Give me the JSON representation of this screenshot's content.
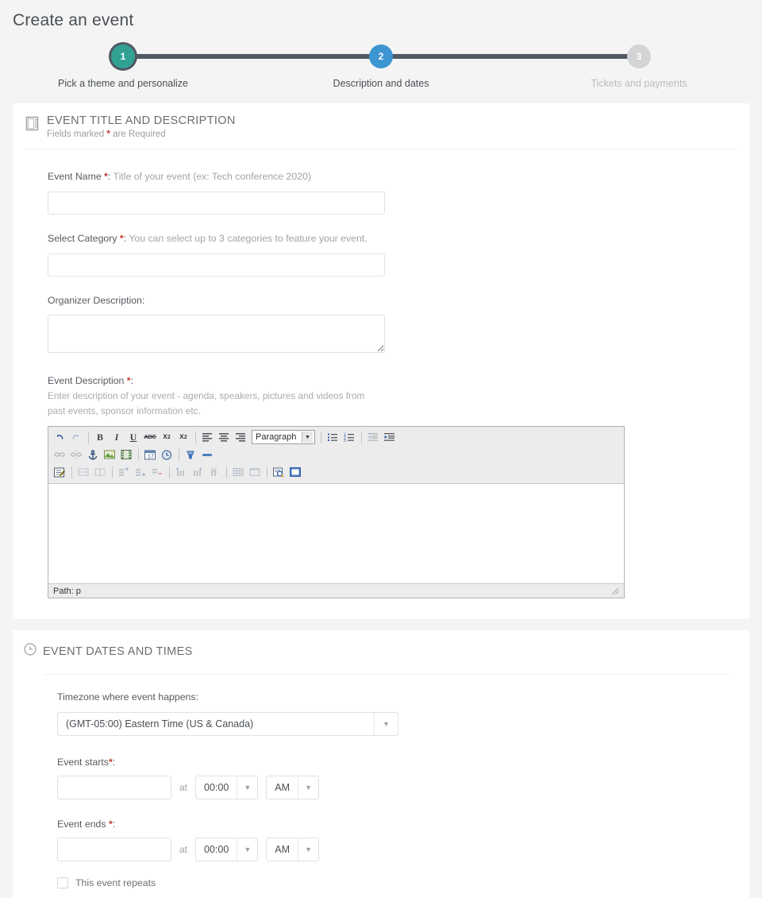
{
  "page": {
    "title": "Create an event"
  },
  "stepper": {
    "steps": [
      {
        "number": "1",
        "label": "Pick a theme and personalize",
        "state": "complete",
        "color": "#31a192"
      },
      {
        "number": "2",
        "label": "Description and dates",
        "state": "current",
        "color": "#3d95d1"
      },
      {
        "number": "3",
        "label": "Tickets and payments",
        "state": "upcoming",
        "color": "#d3d4d5"
      }
    ],
    "line_color": "#515864"
  },
  "section_title_desc": {
    "icon": "notebook-icon",
    "heading": "EVENT TITLE AND DESCRIPTION",
    "sub_prefix": "Fields marked",
    "sub_required_mark": "*",
    "sub_suffix": "are Required",
    "required_color": "#c0392b"
  },
  "fields": {
    "event_name": {
      "label": "Event Name",
      "required_mark": "*",
      "colon": ":",
      "hint": "Title of your event (ex: Tech conference 2020)",
      "value": "",
      "placeholder": ""
    },
    "select_category": {
      "label": "Select Category",
      "required_mark": "*",
      "colon": ":",
      "hint": "You can select up to 3 categories to feature your event.",
      "value": "",
      "placeholder": ""
    },
    "organizer_description": {
      "label": "Organizer Description:",
      "value": "",
      "placeholder": ""
    },
    "event_description": {
      "label": "Event Description",
      "required_mark": "*",
      "colon": ":",
      "help": "Enter description of your event - agenda, speakers, pictures and videos from past events, sponsor information etc."
    }
  },
  "editor": {
    "format_select": "Paragraph",
    "status_path": "Path: p",
    "row1": [
      {
        "name": "undo-icon",
        "glyph": "↶"
      },
      {
        "name": "redo-icon",
        "glyph": "↷"
      },
      {
        "name": "separator",
        "glyph": "|"
      },
      {
        "name": "bold-icon",
        "glyph": "B"
      },
      {
        "name": "italic-icon",
        "glyph": "I"
      },
      {
        "name": "underline-icon",
        "glyph": "U"
      },
      {
        "name": "strikethrough-icon",
        "glyph": "ABC"
      },
      {
        "name": "subscript-icon",
        "glyph": "x₂"
      },
      {
        "name": "superscript-icon",
        "glyph": "x²"
      },
      {
        "name": "separator",
        "glyph": "|"
      },
      {
        "name": "align-left-icon",
        "glyph": "≡"
      },
      {
        "name": "align-center-icon",
        "glyph": "≡"
      },
      {
        "name": "align-right-icon",
        "glyph": "≡"
      },
      {
        "name": "format-select",
        "glyph": "Paragraph"
      },
      {
        "name": "separator",
        "glyph": "|"
      },
      {
        "name": "bullet-list-icon",
        "glyph": "☰"
      },
      {
        "name": "numbered-list-icon",
        "glyph": "☰"
      },
      {
        "name": "separator",
        "glyph": "|"
      },
      {
        "name": "outdent-icon",
        "glyph": "←"
      },
      {
        "name": "indent-icon",
        "glyph": "→"
      }
    ],
    "row2": [
      {
        "name": "link-icon"
      },
      {
        "name": "unlink-icon"
      },
      {
        "name": "anchor-icon"
      },
      {
        "name": "insert-image-icon"
      },
      {
        "name": "insert-media-icon"
      },
      {
        "name": "separator"
      },
      {
        "name": "insert-date-icon"
      },
      {
        "name": "insert-time-icon"
      },
      {
        "name": "separator"
      },
      {
        "name": "cleanup-icon"
      },
      {
        "name": "horizontal-rule-icon"
      }
    ],
    "row3": [
      {
        "name": "edit-html-icon"
      },
      {
        "name": "separator"
      },
      {
        "name": "table-split-cells-icon"
      },
      {
        "name": "table-merge-cells-icon"
      },
      {
        "name": "separator"
      },
      {
        "name": "table-row-before-icon"
      },
      {
        "name": "table-row-after-icon"
      },
      {
        "name": "table-delete-row-icon"
      },
      {
        "name": "separator"
      },
      {
        "name": "table-col-before-icon"
      },
      {
        "name": "table-col-after-icon"
      },
      {
        "name": "table-delete-col-icon"
      },
      {
        "name": "separator"
      },
      {
        "name": "table-insert-icon"
      },
      {
        "name": "table-props-icon"
      },
      {
        "name": "separator"
      },
      {
        "name": "preview-icon"
      },
      {
        "name": "fullscreen-icon"
      }
    ]
  },
  "section_dates": {
    "icon": "clock-icon",
    "heading": "EVENT DATES AND TIMES",
    "timezone": {
      "label": "Timezone where event happens:",
      "value": "(GMT-05:00) Eastern Time (US & Canada)"
    },
    "event_starts": {
      "label": "Event starts",
      "required_mark": "*",
      "colon": ":",
      "date_value": "",
      "at_text": "at",
      "time_value": "00:00",
      "meridiem_value": "AM"
    },
    "event_ends": {
      "label": "Event ends",
      "required_mark": "*",
      "colon": ":",
      "date_value": "",
      "at_text": "at",
      "time_value": "00:00",
      "meridiem_value": "AM"
    },
    "repeats": {
      "label": "This event repeats",
      "checked": false
    }
  }
}
